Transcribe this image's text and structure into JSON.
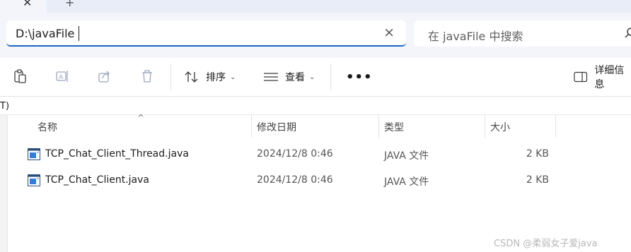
{
  "window": {
    "tab_close_glyph": "✕",
    "tab_new_glyph": "+"
  },
  "address": {
    "path": "D:\\javaFile",
    "search_placeholder": "在 javaFile 中搜索"
  },
  "toolbar": {
    "sort_label": "排序",
    "view_label": "查看",
    "details_label": "详细信息"
  },
  "left_fragment": "T)",
  "columns": {
    "name": "名称",
    "modified": "修改日期",
    "type": "类型",
    "size": "大小"
  },
  "files": [
    {
      "name": "TCP_Chat_Client_Thread.java",
      "modified": "2024/12/8 0:46",
      "type": "JAVA 文件",
      "size": "2 KB"
    },
    {
      "name": "TCP_Chat_Client.java",
      "modified": "2024/12/8 0:46",
      "type": "JAVA 文件",
      "size": "2 KB"
    }
  ],
  "watermark": "CSDN @柔弱女子爱java",
  "colors": {
    "accent": "#1a65c6",
    "tabstrip": "#e8edf7",
    "header_bg": "#f3f5fa"
  }
}
